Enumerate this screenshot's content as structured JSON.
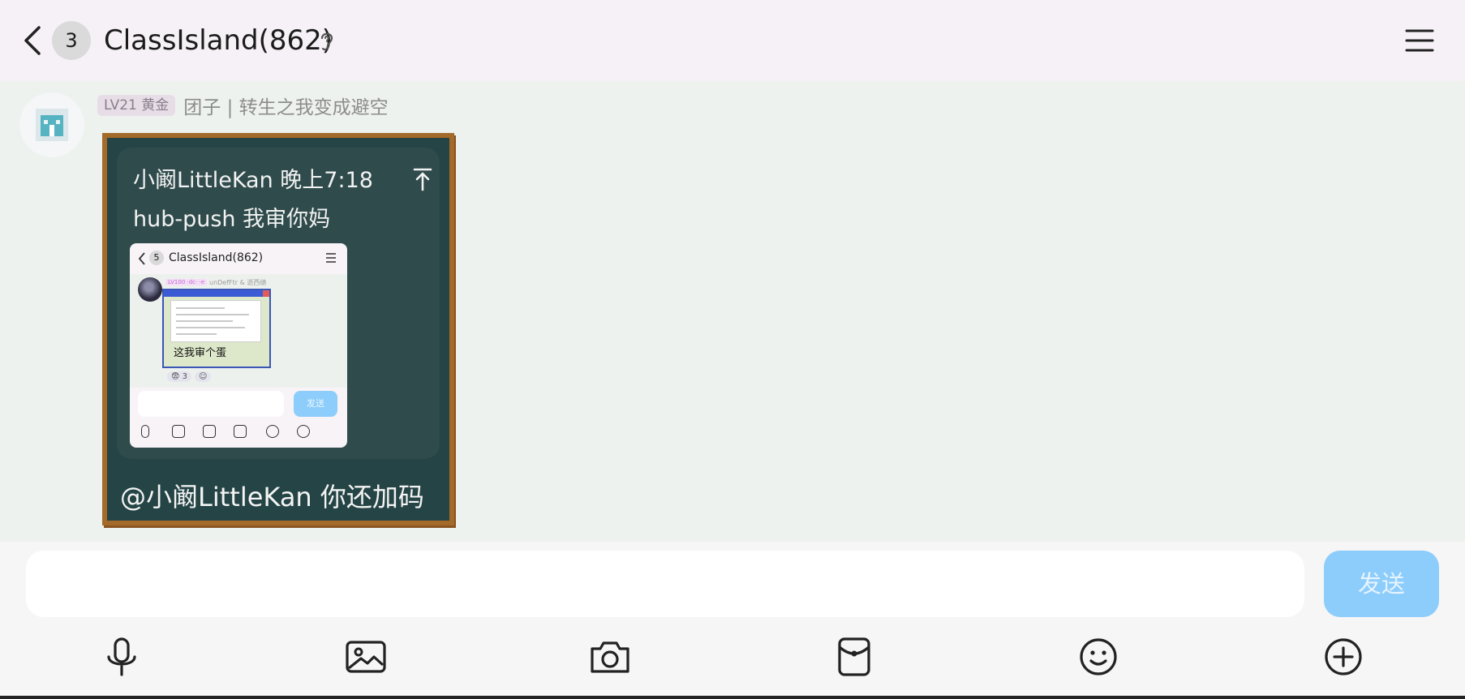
{
  "header": {
    "unread_count": "3",
    "title": "ClassIsland(862)"
  },
  "message": {
    "level_badge": "LV21 黄金",
    "sender": "团子 | 转生之我变成避空",
    "image": {
      "quote_author_time": "小阚LittleKan 晚上7:18",
      "quote_text": "hub-push 我审你妈",
      "caption": "@小阚LittleKan 你还加码",
      "inner_screenshot": {
        "unread_count": "5",
        "title": "ClassIsland(862)",
        "level_badge": "LV100 ·dc· ·e",
        "sender": "unDefFtr & 逝西绩",
        "image_caption": "这我审个蛋",
        "reaction_count": "3",
        "send_label": "发送"
      }
    }
  },
  "composer": {
    "input_value": "",
    "send_label": "发送",
    "tools": [
      "microphone-icon",
      "image-icon",
      "camera-icon",
      "red-packet-icon",
      "emoji-icon",
      "plus-icon"
    ]
  },
  "colors": {
    "header_bg": "#f6f1f6",
    "chat_bg": "#eef2ee",
    "send_button": "#8dcdfb",
    "frame_wood": "#a36a2a",
    "chalkboard": "#254445"
  }
}
